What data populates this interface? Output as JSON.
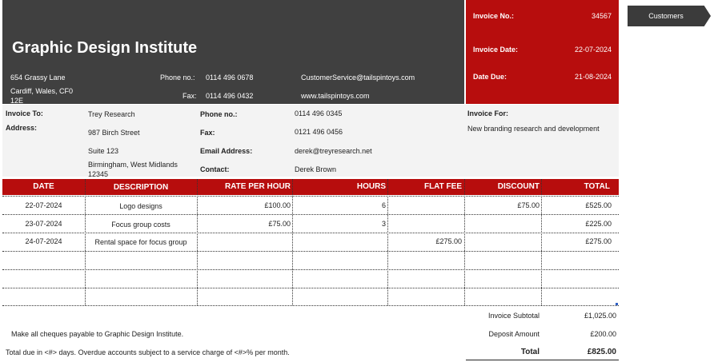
{
  "company": {
    "name": "Graphic Design Institute",
    "address_line1": "654 Grassy Lane",
    "address_line2": "Cardiff, Wales, CF0",
    "address_line3": "12E",
    "phone_label": "Phone no.:",
    "phone": "0114 496 0678",
    "fax_label": "Fax:",
    "fax": "0114 496 0432",
    "email": "CustomerService@tailspintoys.com",
    "website": "www.tailspintoys.com"
  },
  "invoice": {
    "no_label": "Invoice No.:",
    "no": "34567",
    "date_label": "Invoice Date:",
    "date": "22-07-2024",
    "due_label": "Date Due:",
    "due": "21-08-2024"
  },
  "customers_tab": "Customers",
  "bill_to": {
    "to_label": "Invoice To:",
    "to": "Trey Research",
    "address_label": "Address:",
    "address1": "987 Birch Street",
    "address2": "Suite 123",
    "address3": "Birmingham, West Midlands",
    "address4": "12345",
    "phone_label": "Phone no.:",
    "phone": "0114 496 0345",
    "fax_label": "Fax:",
    "fax": "0121 496 0456",
    "email_label": "Email Address:",
    "email": "derek@treyresearch.net",
    "contact_label": "Contact:",
    "contact": "Derek Brown",
    "for_label": "Invoice For:",
    "for": "New branding research and development"
  },
  "table": {
    "headers": [
      "DATE",
      "DESCRIPTION",
      "RATE PER HOUR",
      "HOURS",
      "FLAT FEE",
      "DISCOUNT",
      "TOTAL"
    ],
    "rows": [
      {
        "date": "22-07-2024",
        "description": "Logo designs",
        "rate": "£100.00",
        "hours": "6",
        "flat_fee": "",
        "discount": "£75.00",
        "total": "£525.00"
      },
      {
        "date": "23-07-2024",
        "description": "Focus group costs",
        "rate": "£75.00",
        "hours": "3",
        "flat_fee": "",
        "discount": "",
        "total": "£225.00"
      },
      {
        "date": "24-07-2024",
        "description": "Rental space for focus group",
        "rate": "",
        "hours": "",
        "flat_fee": "£275.00",
        "discount": "",
        "total": "£275.00"
      }
    ]
  },
  "summary": {
    "subtotal_label": "Invoice Subtotal",
    "subtotal": "£1,025.00",
    "deposit_label": "Deposit Amount",
    "deposit": "£200.00",
    "total_label": "Total",
    "total": "£825.00"
  },
  "notes": {
    "cheques": "Make all cheques payable to Graphic Design Institute.",
    "terms": "Total due in <#> days. Overdue accounts subject to a service charge of <#>% per month."
  },
  "colors": {
    "dark": "#404040",
    "accent": "#b70d0d",
    "band": "#f3f3f3"
  }
}
